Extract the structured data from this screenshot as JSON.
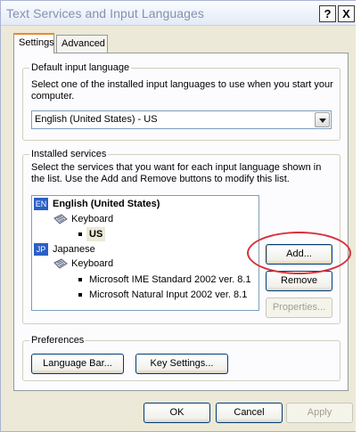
{
  "window": {
    "title": "Text Services and Input Languages",
    "help_button": "?",
    "close_button": "X"
  },
  "tabs": [
    {
      "label": "Settings",
      "active": true
    },
    {
      "label": "Advanced",
      "active": false
    }
  ],
  "default_language": {
    "legend": "Default input language",
    "description": "Select one of the installed input languages to use when you start your computer.",
    "selected": "English (United States) - US"
  },
  "installed_services": {
    "legend": "Installed services",
    "description": "Select the services that you want for each input language shown in the list. Use the Add and Remove buttons to modify this list.",
    "languages": [
      {
        "badge": "EN",
        "name": "English (United States)",
        "category": "Keyboard",
        "items": [
          "US"
        ]
      },
      {
        "badge": "JP",
        "name": "Japanese",
        "category": "Keyboard",
        "items": [
          "Microsoft IME Standard 2002 ver. 8.1",
          "Microsoft Natural Input 2002 ver. 8.1"
        ]
      }
    ],
    "buttons": {
      "add": "Add...",
      "remove": "Remove",
      "properties": "Properties..."
    }
  },
  "preferences": {
    "legend": "Preferences",
    "language_bar": "Language Bar...",
    "key_settings": "Key Settings..."
  },
  "footer": {
    "ok": "OK",
    "cancel": "Cancel",
    "apply": "Apply"
  },
  "colors": {
    "annotation_ring": "#d6303a",
    "lang_badge": "#2b5ec7"
  }
}
